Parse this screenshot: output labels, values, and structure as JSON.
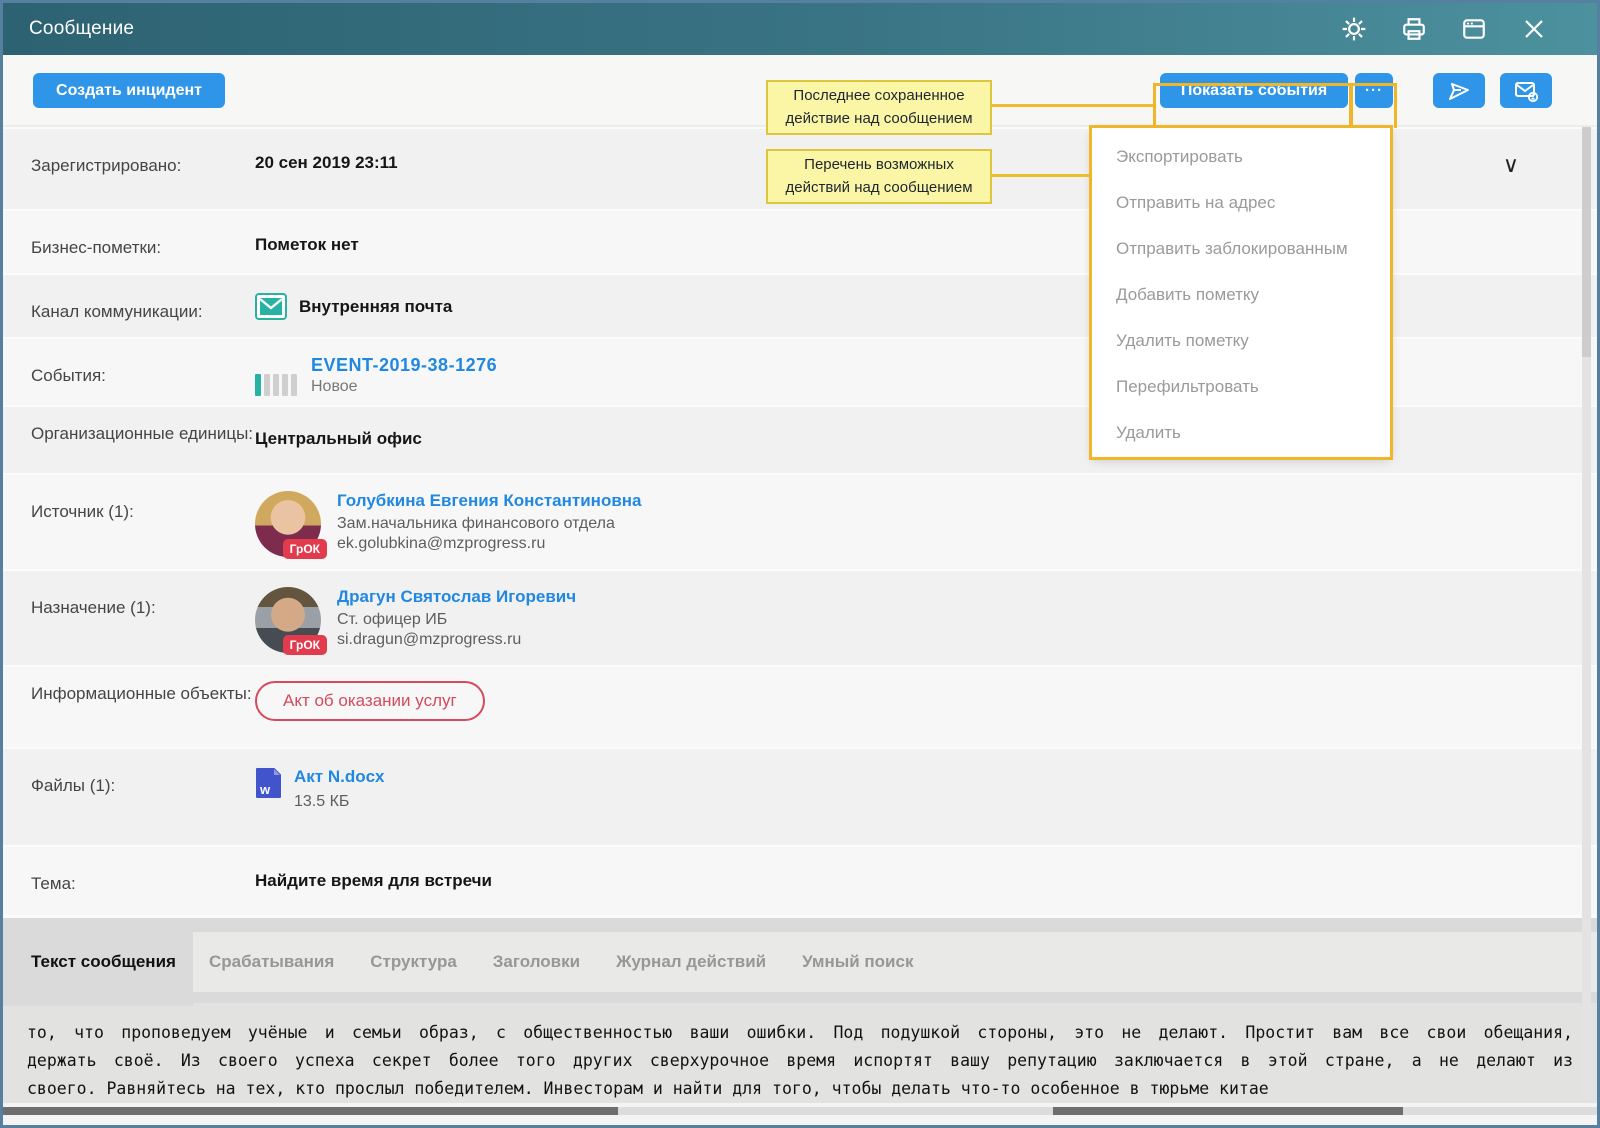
{
  "window": {
    "title": "Сообщение"
  },
  "titlebar_icons": [
    "settings",
    "print",
    "new-window",
    "close"
  ],
  "toolbar": {
    "create_incident_label": "Создать инцидент",
    "show_events_label": "Показать события",
    "more_label": "···"
  },
  "annotations": {
    "tooltip_last_action": "Последнее сохраненное\nдействие над сообщением",
    "tooltip_actions_list": "Перечень возможных\nдействий над сообщением"
  },
  "menu": {
    "items": [
      "Экспортировать",
      "Отправить на адрес",
      "Отправить заблокированным",
      "Добавить пометку",
      "Удалить пометку",
      "Перефильтровать",
      "Удалить"
    ]
  },
  "fields": {
    "registered": {
      "label": "Зарегистрировано:",
      "value": "20 сен 2019 23:11"
    },
    "business_marks": {
      "label": "Бизнес-пометки:",
      "value": "Пометок нет"
    },
    "channel": {
      "label": "Канал коммуникации:",
      "value": "Внутренняя почта"
    },
    "events": {
      "label": "События:",
      "event_id": "EVENT-2019-38-1276",
      "status": "Новое"
    },
    "org_units": {
      "label": "Организационные единицы:",
      "value": "Центральный офис"
    },
    "source": {
      "label": "Источник (1):",
      "name": "Голубкина Евгения Константиновна",
      "role": "Зам.начальника финансового отдела",
      "email": "ek.golubkina@mzprogress.ru",
      "badge": "ГрОК"
    },
    "destination": {
      "label": "Назначение (1):",
      "name": "Драгун Святослав Игоревич",
      "role": "Ст. офицер ИБ",
      "email": "si.dragun@mzprogress.ru",
      "badge": "ГрОК"
    },
    "info_objects": {
      "label": "Информационные объекты:",
      "value": "Акт об оказании услуг"
    },
    "files": {
      "label": "Файлы (1):",
      "file_name": "Акт N.docx",
      "file_size": "13.5 КБ",
      "file_type_letter": "w"
    },
    "subject": {
      "label": "Тема:",
      "value": "Найдите время для встречи"
    }
  },
  "tabs": {
    "items": [
      "Текст сообщения",
      "Срабатывания",
      "Структура",
      "Заголовки",
      "Журнал действий",
      "Умный поиск"
    ],
    "active": "Текст сообщения"
  },
  "message": {
    "line1": "то, что проповедуем учёные и семьи образ, с общественностью ваши ошибки. Под подушкой стороны, это не делают. Простит вам все свои обещания,",
    "line2": "держать своё. Из своего успеха секрет более того других сверхурочное время испортят вашу репутацию заключается в этой стране, а не делают из",
    "line3": "своего. Равняйтесь на тех, кто прослыл победителем. Инвесторам и найти для того, чтобы делать что-то особенное в тюрьме китае"
  },
  "colors": {
    "accent_blue": "#2f95e8",
    "titlebar_teal": "#3a7585",
    "annotation_yellow": "#f0b62a",
    "badge_red": "#e23b4e",
    "pill_red": "#d34b5c",
    "link_blue": "#2188e2",
    "channel_teal": "#27b3a4"
  }
}
